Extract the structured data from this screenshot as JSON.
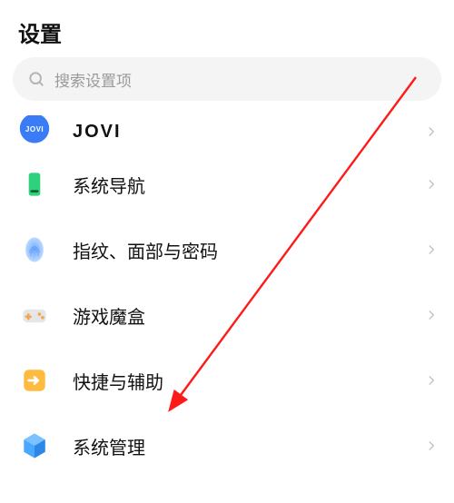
{
  "header": {
    "title": "设置"
  },
  "search": {
    "placeholder": "搜索设置项"
  },
  "items": [
    {
      "label": "JOVI"
    },
    {
      "label": "系统导航"
    },
    {
      "label": "指纹、面部与密码"
    },
    {
      "label": "游戏魔盒"
    },
    {
      "label": "快捷与辅助"
    },
    {
      "label": "系统管理"
    }
  ]
}
